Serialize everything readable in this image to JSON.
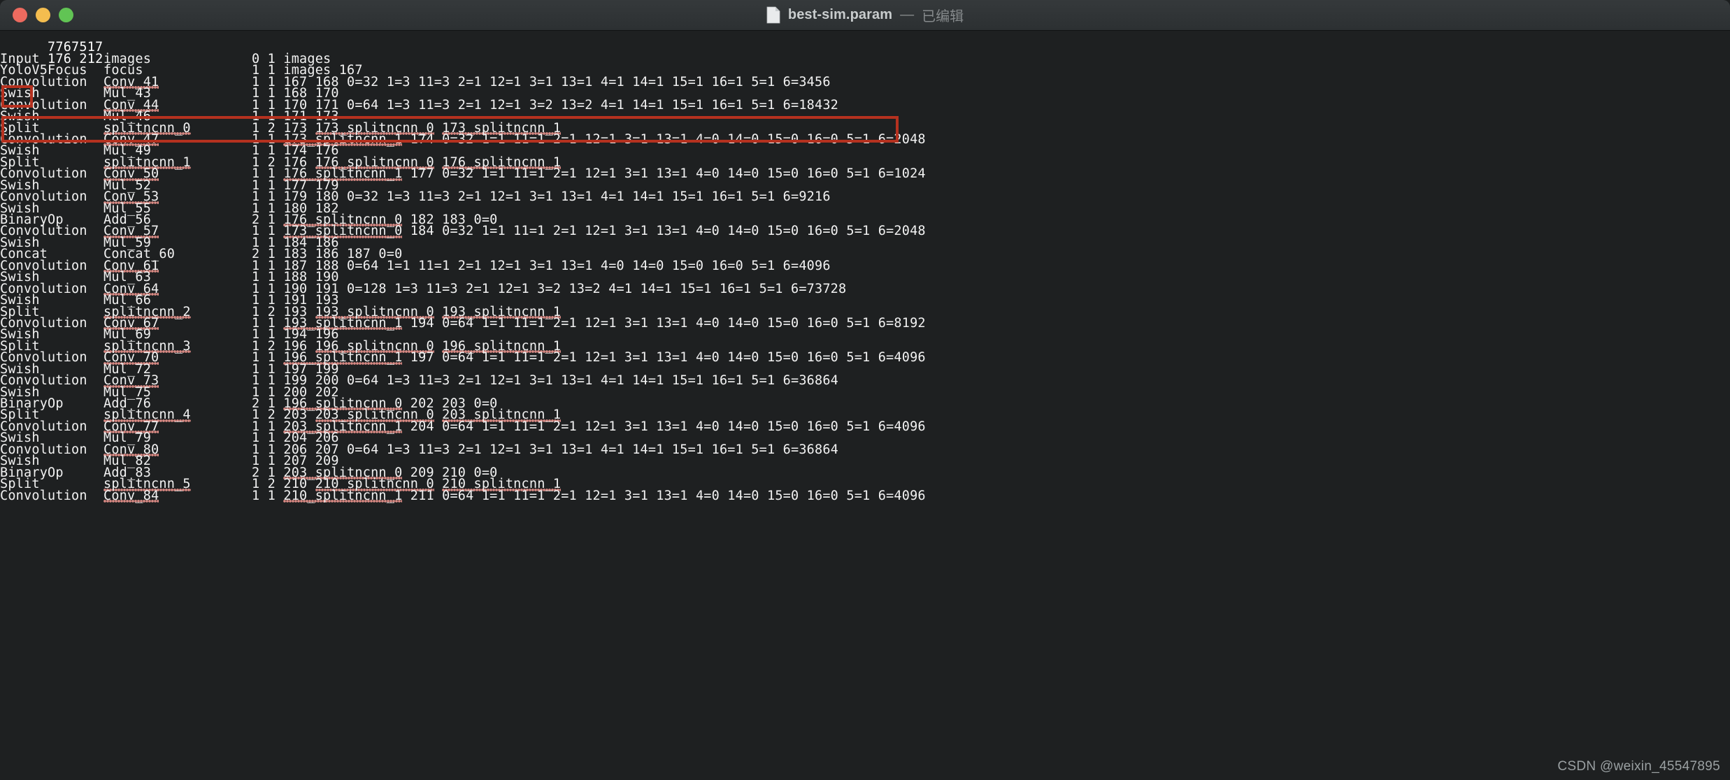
{
  "window": {
    "title": "best-sim.param",
    "separator": "—",
    "edited_label": "已编辑",
    "icon": "document-icon",
    "traffic_lights": {
      "close": "close-button",
      "minimize": "minimize-button",
      "zoom": "zoom-button"
    },
    "colors": {
      "background": "#1e2021",
      "titlebar": "#2f3335",
      "text": "#f2f2f2",
      "annotation": "#b5311f",
      "spellcheck": "#d98a84",
      "close": "#ec6a5f",
      "minimize": "#f4bd4f",
      "zoom": "#61c454"
    }
  },
  "watermark": "CSDN @weixin_45547895",
  "document": {
    "magic": "7767517",
    "counts": {
      "layer_count": "176",
      "blob_count": "212"
    },
    "lines": [
      {
        "type": "Input",
        "name": "images",
        "args": "0 1 images",
        "sp_name": false,
        "sp_args": []
      },
      {
        "type": "YoloV5Focus",
        "name": "focus",
        "args": "1 1 images 167",
        "sp_name": false,
        "sp_args": []
      },
      {
        "type": "Convolution",
        "name": "Conv_41",
        "args": "1 1 167 168 0=32 1=3 11=3 2=1 12=1 3=1 13=1 4=1 14=1 15=1 16=1 5=1 6=3456",
        "sp_name": true,
        "sp_args": []
      },
      {
        "type": "Swish",
        "name": "Mul_43",
        "args": "1 1 168 170",
        "sp_name": false,
        "sp_args": []
      },
      {
        "type": "Convolution",
        "name": "Conv_44",
        "args": "1 1 170 171 0=64 1=3 11=3 2=1 12=1 3=2 13=2 4=1 14=1 15=1 16=1 5=1 6=18432",
        "sp_name": true,
        "sp_args": []
      },
      {
        "type": "Swish",
        "name": "Mul_46",
        "args": "1 1 171 173",
        "sp_name": false,
        "sp_args": []
      },
      {
        "type": "Split",
        "name": "splitncnn_0",
        "args": "1 2 173 173_splitncnn_0 173_splitncnn_1",
        "sp_name": true,
        "sp_args": [
          "173_splitncnn_0",
          "173_splitncnn_1"
        ]
      },
      {
        "type": "Convolution",
        "name": "Conv_47",
        "args": "1 1 173_splitncnn_1 174 0=32 1=1 11=1 2=1 12=1 3=1 13=1 4=0 14=0 15=0 16=0 5=1 6=2048",
        "sp_name": true,
        "sp_args": [
          "173_splitncnn_1"
        ]
      },
      {
        "type": "Swish",
        "name": "Mul_49",
        "args": "1 1 174 176",
        "sp_name": false,
        "sp_args": []
      },
      {
        "type": "Split",
        "name": "splitncnn_1",
        "args": "1 2 176 176_splitncnn_0 176_splitncnn_1",
        "sp_name": true,
        "sp_args": [
          "176_splitncnn_0",
          "176_splitncnn_1"
        ]
      },
      {
        "type": "Convolution",
        "name": "Conv_50",
        "args": "1 1 176_splitncnn_1 177 0=32 1=1 11=1 2=1 12=1 3=1 13=1 4=0 14=0 15=0 16=0 5=1 6=1024",
        "sp_name": true,
        "sp_args": [
          "176_splitncnn_1"
        ]
      },
      {
        "type": "Swish",
        "name": "Mul_52",
        "args": "1 1 177 179",
        "sp_name": false,
        "sp_args": []
      },
      {
        "type": "Convolution",
        "name": "Conv_53",
        "args": "1 1 179 180 0=32 1=3 11=3 2=1 12=1 3=1 13=1 4=1 14=1 15=1 16=1 5=1 6=9216",
        "sp_name": true,
        "sp_args": []
      },
      {
        "type": "Swish",
        "name": "Mul_55",
        "args": "1 1 180 182",
        "sp_name": false,
        "sp_args": []
      },
      {
        "type": "BinaryOp",
        "name": "Add_56",
        "args": "2 1 176_splitncnn_0 182 183 0=0",
        "sp_name": false,
        "sp_args": [
          "176_splitncnn_0"
        ]
      },
      {
        "type": "Convolution",
        "name": "Conv_57",
        "args": "1 1 173_splitncnn_0 184 0=32 1=1 11=1 2=1 12=1 3=1 13=1 4=0 14=0 15=0 16=0 5=1 6=2048",
        "sp_name": true,
        "sp_args": [
          "173_splitncnn_0"
        ]
      },
      {
        "type": "Swish",
        "name": "Mul_59",
        "args": "1 1 184 186",
        "sp_name": false,
        "sp_args": []
      },
      {
        "type": "Concat",
        "name": "Concat_60",
        "args": "2 1 183 186 187 0=0",
        "sp_name": false,
        "sp_args": []
      },
      {
        "type": "Convolution",
        "name": "Conv_61",
        "args": "1 1 187 188 0=64 1=1 11=1 2=1 12=1 3=1 13=1 4=0 14=0 15=0 16=0 5=1 6=4096",
        "sp_name": true,
        "sp_args": []
      },
      {
        "type": "Swish",
        "name": "Mul_63",
        "args": "1 1 188 190",
        "sp_name": false,
        "sp_args": []
      },
      {
        "type": "Convolution",
        "name": "Conv_64",
        "args": "1 1 190 191 0=128 1=3 11=3 2=1 12=1 3=2 13=2 4=1 14=1 15=1 16=1 5=1 6=73728",
        "sp_name": true,
        "sp_args": []
      },
      {
        "type": "Swish",
        "name": "Mul_66",
        "args": "1 1 191 193",
        "sp_name": false,
        "sp_args": []
      },
      {
        "type": "Split",
        "name": "splitncnn_2",
        "args": "1 2 193 193_splitncnn_0 193_splitncnn_1",
        "sp_name": true,
        "sp_args": [
          "193_splitncnn_0",
          "193_splitncnn_1"
        ]
      },
      {
        "type": "Convolution",
        "name": "Conv_67",
        "args": "1 1 193_splitncnn_1 194 0=64 1=1 11=1 2=1 12=1 3=1 13=1 4=0 14=0 15=0 16=0 5=1 6=8192",
        "sp_name": true,
        "sp_args": [
          "193_splitncnn_1"
        ]
      },
      {
        "type": "Swish",
        "name": "Mul_69",
        "args": "1 1 194 196",
        "sp_name": false,
        "sp_args": []
      },
      {
        "type": "Split",
        "name": "splitncnn_3",
        "args": "1 2 196 196_splitncnn_0 196_splitncnn_1",
        "sp_name": true,
        "sp_args": [
          "196_splitncnn_0",
          "196_splitncnn_1"
        ]
      },
      {
        "type": "Convolution",
        "name": "Conv_70",
        "args": "1 1 196_splitncnn_1 197 0=64 1=1 11=1 2=1 12=1 3=1 13=1 4=0 14=0 15=0 16=0 5=1 6=4096",
        "sp_name": true,
        "sp_args": [
          "196_splitncnn_1"
        ]
      },
      {
        "type": "Swish",
        "name": "Mul_72",
        "args": "1 1 197 199",
        "sp_name": false,
        "sp_args": []
      },
      {
        "type": "Convolution",
        "name": "Conv_73",
        "args": "1 1 199 200 0=64 1=3 11=3 2=1 12=1 3=1 13=1 4=1 14=1 15=1 16=1 5=1 6=36864",
        "sp_name": true,
        "sp_args": []
      },
      {
        "type": "Swish",
        "name": "Mul_75",
        "args": "1 1 200 202",
        "sp_name": false,
        "sp_args": []
      },
      {
        "type": "BinaryOp",
        "name": "Add_76",
        "args": "2 1 196_splitncnn_0 202 203 0=0",
        "sp_name": false,
        "sp_args": [
          "196_splitncnn_0"
        ]
      },
      {
        "type": "Split",
        "name": "splitncnn_4",
        "args": "1 2 203 203_splitncnn_0 203_splitncnn_1",
        "sp_name": true,
        "sp_args": [
          "203_splitncnn_0",
          "203_splitncnn_1"
        ]
      },
      {
        "type": "Convolution",
        "name": "Conv_77",
        "args": "1 1 203_splitncnn_1 204 0=64 1=1 11=1 2=1 12=1 3=1 13=1 4=0 14=0 15=0 16=0 5=1 6=4096",
        "sp_name": true,
        "sp_args": [
          "203_splitncnn_1"
        ]
      },
      {
        "type": "Swish",
        "name": "Mul_79",
        "args": "1 1 204 206",
        "sp_name": false,
        "sp_args": []
      },
      {
        "type": "Convolution",
        "name": "Conv_80",
        "args": "1 1 206 207 0=64 1=3 11=3 2=1 12=1 3=1 13=1 4=1 14=1 15=1 16=1 5=1 6=36864",
        "sp_name": true,
        "sp_args": []
      },
      {
        "type": "Swish",
        "name": "Mul_82",
        "args": "1 1 207 209",
        "sp_name": false,
        "sp_args": []
      },
      {
        "type": "BinaryOp",
        "name": "Add_83",
        "args": "2 1 203_splitncnn_0 209 210 0=0",
        "sp_name": false,
        "sp_args": [
          "203_splitncnn_0"
        ]
      },
      {
        "type": "Split",
        "name": "splitncnn_5",
        "args": "1 2 210 210_splitncnn_0 210_splitncnn_1",
        "sp_name": true,
        "sp_args": [
          "210_splitncnn_0",
          "210_splitncnn_1"
        ]
      },
      {
        "type": "Convolution",
        "name": "Conv_84",
        "args": "1 1 210_splitncnn_1 211 0=64 1=1 11=1 2=1 12=1 3=1 13=1 4=0 14=0 15=0 16=0 5=1 6=4096",
        "sp_name": true,
        "sp_args": [
          "210_splitncnn_1"
        ]
      }
    ],
    "annotations": [
      {
        "name": "layer-count-highlight",
        "target": "176"
      },
      {
        "name": "yolov5focus-row-highlight",
        "target": "YoloV5Focus focus 1 1 images 167"
      }
    ]
  }
}
